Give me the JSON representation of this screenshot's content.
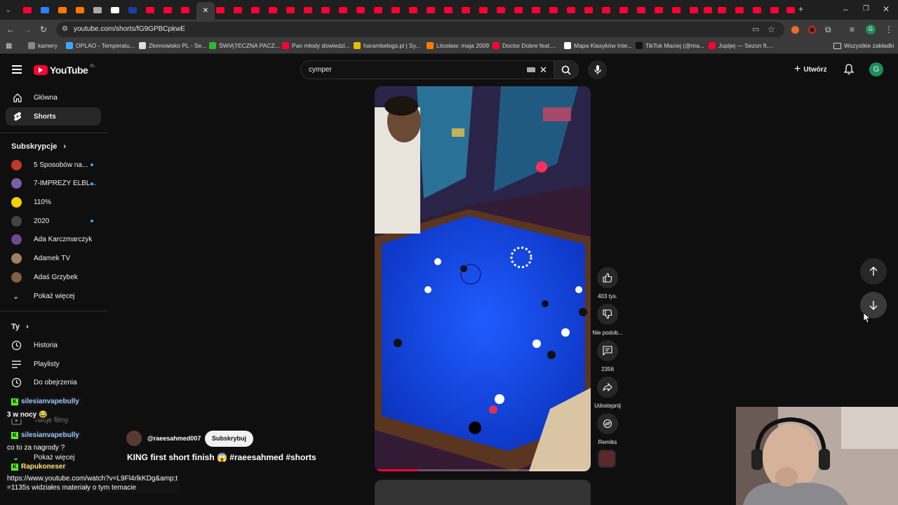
{
  "browser": {
    "url": "youtube.com/shorts/fG9GPBCpkwE",
    "bookmarks": [
      {
        "label": "kamery",
        "color": "#888888"
      },
      {
        "label": "OPLAO - Temperatu...",
        "color": "#3ea6ff"
      },
      {
        "label": "Złomowisko PL - Se...",
        "color": "#dddddd"
      },
      {
        "label": "ŚWIĄTECZNA PACZ...",
        "color": "#2eb82e"
      },
      {
        "label": "Pan młody dowiedzi...",
        "color": "#ff0033"
      },
      {
        "label": "harambelogs.pl | Sy...",
        "color": "#e3c000"
      },
      {
        "label": "Litosław: maja 2009",
        "color": "#ff7a00"
      },
      {
        "label": "Doctor Dobre feat....",
        "color": "#ff0033"
      },
      {
        "label": "Mapa Klasyków Inte...",
        "color": "#ffffff"
      },
      {
        "label": "TikTok Maciej (@ma...",
        "color": "#111111"
      },
      {
        "label": "Jupijej — Sezon ft....",
        "color": "#ff0033"
      }
    ],
    "all_bookmarks": "Wszystkie zakładki"
  },
  "youtube": {
    "logo": "YouTube",
    "logo_region": "PL",
    "search_value": "cymper",
    "create_label": "Utwórz",
    "avatar_letter": "G",
    "sidebar": {
      "main": [
        {
          "label": "Główna",
          "icon": "home-icon"
        },
        {
          "label": "Shorts",
          "icon": "shorts-icon",
          "selected": true
        }
      ],
      "subscriptions_title": "Subskrypcje",
      "subscriptions": [
        {
          "label": "5 Sposobów na...",
          "color": "#c0392b",
          "new": true
        },
        {
          "label": "7-IMPREZY ELBL...",
          "color": "#7a5ea8",
          "new": true
        },
        {
          "label": "110%",
          "color": "#f5d000",
          "new": false
        },
        {
          "label": "2020",
          "color": "#444444",
          "new": true
        },
        {
          "label": "Ada Karczmarczyk",
          "color": "#6a4a8c",
          "new": false
        },
        {
          "label": "Adamek TV",
          "color": "#a08060",
          "new": false
        },
        {
          "label": "Adaś Grzybek",
          "color": "#806040",
          "new": false
        }
      ],
      "show_more": "Pokaż więcej",
      "you_title": "Ty",
      "you_items": [
        {
          "label": "Historia",
          "icon": "history-icon"
        },
        {
          "label": "Playlisty",
          "icon": "playlist-icon"
        },
        {
          "label": "Do obejrzenia",
          "icon": "watch-later-icon"
        },
        {
          "label": "Twoje filmy",
          "icon": "your-videos-icon"
        },
        {
          "label": "Pokaż więcej",
          "icon": "chevron-down-icon"
        }
      ]
    },
    "short": {
      "channel": "@raeesahmed007",
      "subscribe_label": "Subskrybuj",
      "title": "KING first short finish 😱 #raeesahmed #shorts",
      "likes": "403 tys.",
      "dislike_label": "Nie podob...",
      "comments": "2356",
      "share_label": "Udostępnij",
      "remix_label": "Remiks",
      "progress": 0.2
    }
  },
  "chat": [
    {
      "user": "silesianvapebully",
      "message": "3 w nocy 😂"
    },
    {
      "user": "silesianvapebully",
      "message": "co to za nagrody ?"
    },
    {
      "user": "Rapukoneser",
      "message": "https://www.youtube.com/watch?v=L9Fl4rlkKDg&amp;t=1135s widziałes materiały o tym temacie"
    }
  ]
}
